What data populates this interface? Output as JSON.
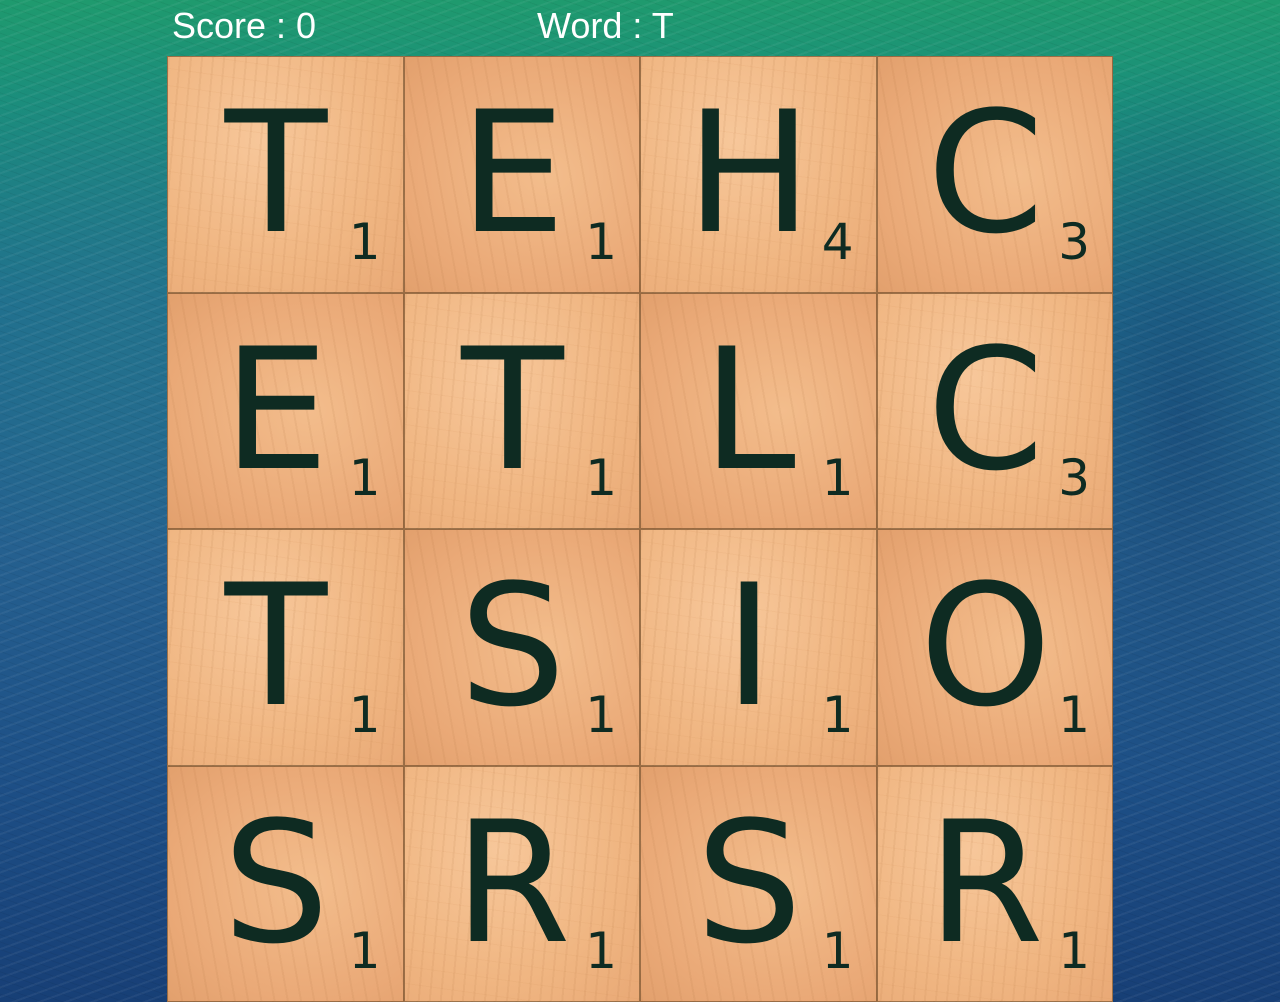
{
  "hud": {
    "score_label": "Score : 0",
    "word_label": "Word : T"
  },
  "board": {
    "tiles": [
      {
        "letter": "T",
        "points": "1"
      },
      {
        "letter": "E",
        "points": "1"
      },
      {
        "letter": "H",
        "points": "4"
      },
      {
        "letter": "C",
        "points": "3"
      },
      {
        "letter": "E",
        "points": "1"
      },
      {
        "letter": "T",
        "points": "1"
      },
      {
        "letter": "L",
        "points": "1"
      },
      {
        "letter": "C",
        "points": "3"
      },
      {
        "letter": "T",
        "points": "1"
      },
      {
        "letter": "S",
        "points": "1"
      },
      {
        "letter": "I",
        "points": "1"
      },
      {
        "letter": "O",
        "points": "1"
      },
      {
        "letter": "S",
        "points": "1"
      },
      {
        "letter": "R",
        "points": "1"
      },
      {
        "letter": "S",
        "points": "1"
      },
      {
        "letter": "R",
        "points": "1"
      }
    ]
  },
  "colors": {
    "tile_ink": "#0e2b22",
    "hud_text": "#ffffff",
    "tile_wood": "#f0b682"
  }
}
